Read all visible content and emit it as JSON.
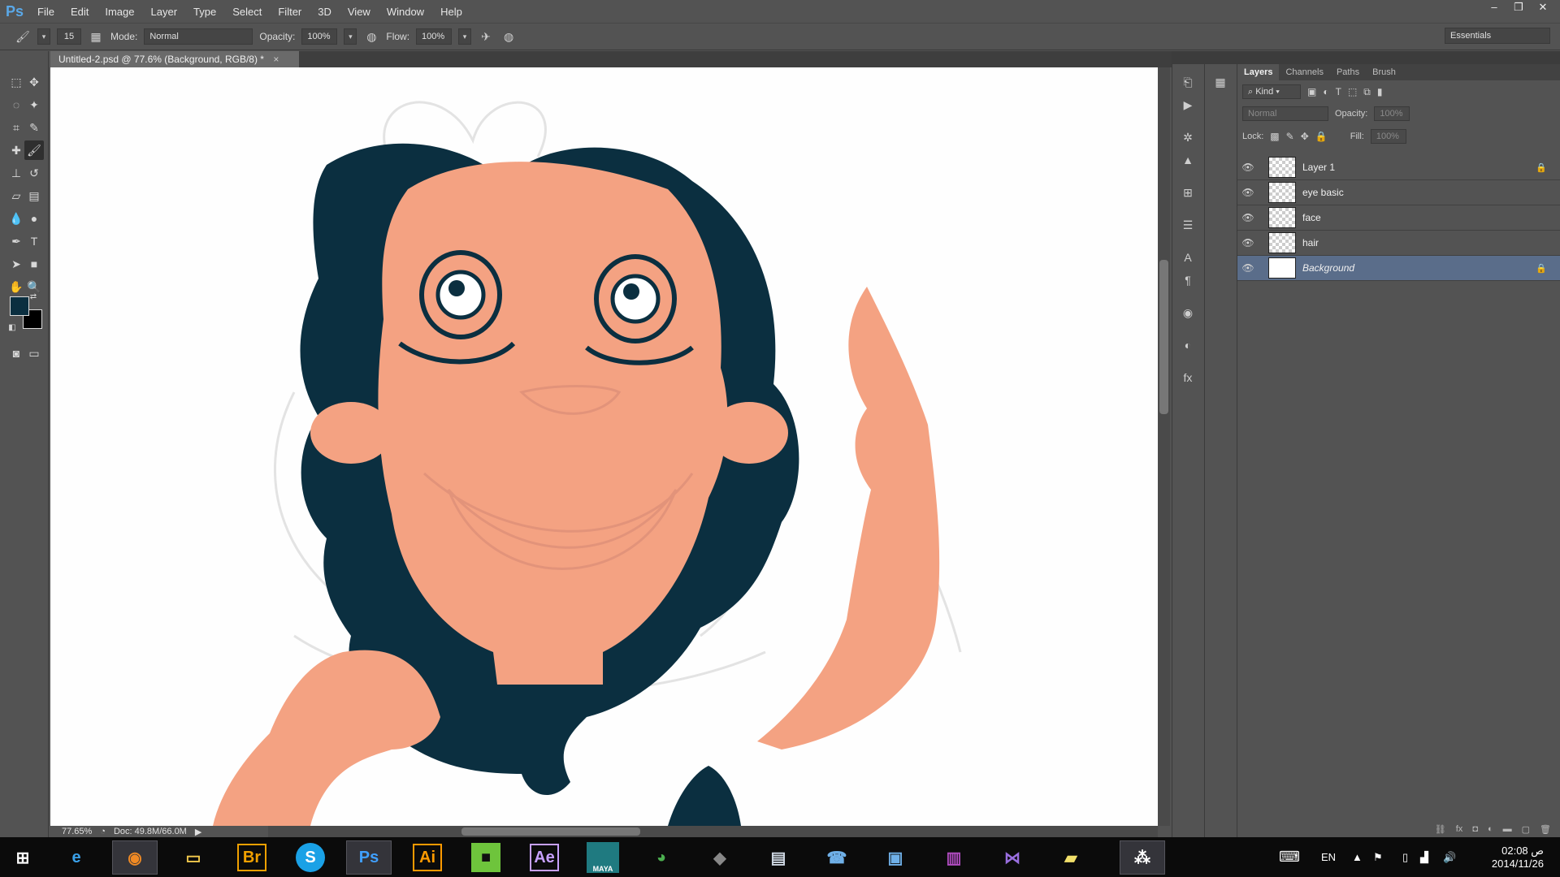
{
  "app": {
    "logo": "Ps"
  },
  "menu": [
    "File",
    "Edit",
    "Image",
    "Layer",
    "Type",
    "Select",
    "Filter",
    "3D",
    "View",
    "Window",
    "Help"
  ],
  "window_controls": {
    "minimize": "–",
    "restore": "❐",
    "close": "✕"
  },
  "options": {
    "brush_size": "15",
    "mode_label": "Mode:",
    "mode_value": "Normal",
    "opacity_label": "Opacity:",
    "opacity_value": "100%",
    "flow_label": "Flow:",
    "flow_value": "100%",
    "workspace": "Essentials"
  },
  "document": {
    "tab_title": "Untitled-2.psd @ 77.6% (Background, RGB/8) *",
    "close": "×",
    "zoom": "77.65%",
    "doc_size": "Doc: 49.8M/66.0M"
  },
  "colors": {
    "foreground": "#0b2f40",
    "background": "#000000",
    "skin": "#f4a282",
    "hair": "#0b2f40"
  },
  "layers_panel": {
    "tabs": [
      "Layers",
      "Channels",
      "Paths",
      "Brush"
    ],
    "filter_kind": "Kind",
    "blend_mode": "Normal",
    "opacity_label": "Opacity:",
    "opacity_value": "100%",
    "lock_label": "Lock:",
    "fill_label": "Fill:",
    "fill_value": "100%",
    "layers": [
      {
        "name": "Layer 1",
        "locked": true,
        "selected": false
      },
      {
        "name": "eye basic",
        "locked": false,
        "selected": false
      },
      {
        "name": "face",
        "locked": false,
        "selected": false
      },
      {
        "name": "hair",
        "locked": false,
        "selected": false
      },
      {
        "name": "Background",
        "locked": true,
        "selected": true
      }
    ]
  },
  "taskbar": {
    "apps": [
      "Windows",
      "Internet Explorer",
      "Firefox",
      "File Explorer",
      "Bridge",
      "Skype",
      "Photoshop",
      "Illustrator",
      "Camtasia",
      "After Effects",
      "Maya",
      "Internet Download Manager",
      "Device",
      "Monitor",
      "Contacts",
      "Remote Desktop",
      "WinRAR",
      "Visual Studio",
      "Sticky Notes",
      "BlackBerry"
    ],
    "labels": {
      "bridge": "Br",
      "skype": "S",
      "photoshop": "Ps",
      "illustrator": "Ai",
      "after_effects": "Ae",
      "maya": "MAYA"
    },
    "language": "EN",
    "time": "02:08 ص",
    "date": "2014/11/26"
  }
}
